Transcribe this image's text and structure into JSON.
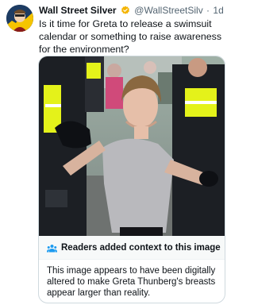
{
  "tweet": {
    "author_name": "Wall Street Silver",
    "handle": "@WallStreetSilv",
    "separator": "·",
    "time": "1d",
    "text": "Is it time for Greta to release a swimsuit calendar or something to raise awareness for the environment?"
  },
  "community_note": {
    "title": "Readers added context to this image",
    "body": "This image appears to have been digitally altered to make Greta Thunberg's breasts appear larger than reality."
  },
  "colors": {
    "verified_badge": "#f4b400",
    "note_icon": "#1d9bf0",
    "text_primary": "#0f1419",
    "text_secondary": "#536471",
    "police_vest": "#e4f21a"
  },
  "icons": {
    "verified": "verified-badge-icon",
    "note": "community-notes-people-icon"
  }
}
